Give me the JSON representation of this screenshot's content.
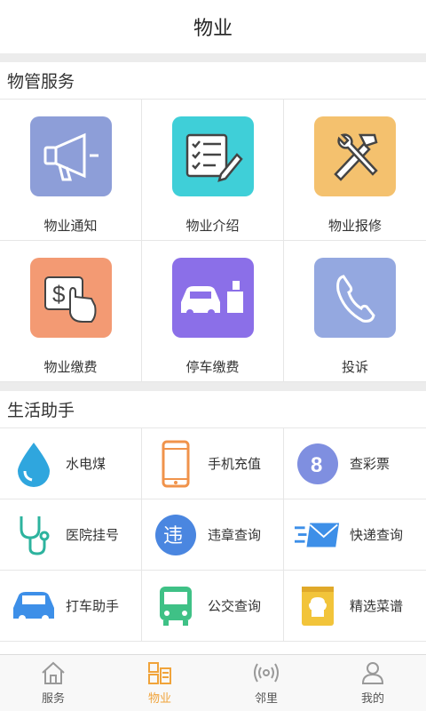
{
  "header": {
    "title": "物业"
  },
  "sections": [
    {
      "title": "物管服务"
    },
    {
      "title": "生活助手"
    }
  ],
  "property_services": [
    {
      "label": "物业通知",
      "icon": "megaphone-icon",
      "color": "#8d9ed8"
    },
    {
      "label": "物业介绍",
      "icon": "checklist-icon",
      "color": "#3fcfd8"
    },
    {
      "label": "物业报修",
      "icon": "wrench-hammer-icon",
      "color": "#f4c16e"
    },
    {
      "label": "物业缴费",
      "icon": "pay-hand-icon",
      "color": "#f39a73"
    },
    {
      "label": "停车缴费",
      "icon": "parking-car-icon",
      "color": "#8b6fe8"
    },
    {
      "label": "投诉",
      "icon": "phone-icon",
      "color": "#94a8e0"
    }
  ],
  "life_helpers": [
    {
      "label": "水电煤",
      "icon": "water-drop-icon",
      "color": "#2fa6de"
    },
    {
      "label": "手机充值",
      "icon": "mobile-icon",
      "color": "#f0934b"
    },
    {
      "label": "查彩票",
      "icon": "lottery-8-icon",
      "color": "#7f8fe0"
    },
    {
      "label": "医院挂号",
      "icon": "stethoscope-icon",
      "color": "#2db39e"
    },
    {
      "label": "违章查询",
      "icon": "violation-icon",
      "color": "#4a86e0",
      "glyph": "违"
    },
    {
      "label": "快递查询",
      "icon": "express-mail-icon",
      "color": "#3d8fe8"
    },
    {
      "label": "打车助手",
      "icon": "taxi-icon",
      "color": "#3d8fe8"
    },
    {
      "label": "公交查询",
      "icon": "bus-icon",
      "color": "#3fc186"
    },
    {
      "label": "精选菜谱",
      "icon": "recipe-book-icon",
      "color": "#f2c43a"
    }
  ],
  "tabs": [
    {
      "label": "服务",
      "icon": "home-icon",
      "active": false
    },
    {
      "label": "物业",
      "icon": "property-icon",
      "active": true
    },
    {
      "label": "邻里",
      "icon": "neighbor-signal-icon",
      "active": false
    },
    {
      "label": "我的",
      "icon": "user-icon",
      "active": false
    }
  ],
  "colors": {
    "active_tab": "#f0a33a",
    "divider": "#ececec"
  }
}
